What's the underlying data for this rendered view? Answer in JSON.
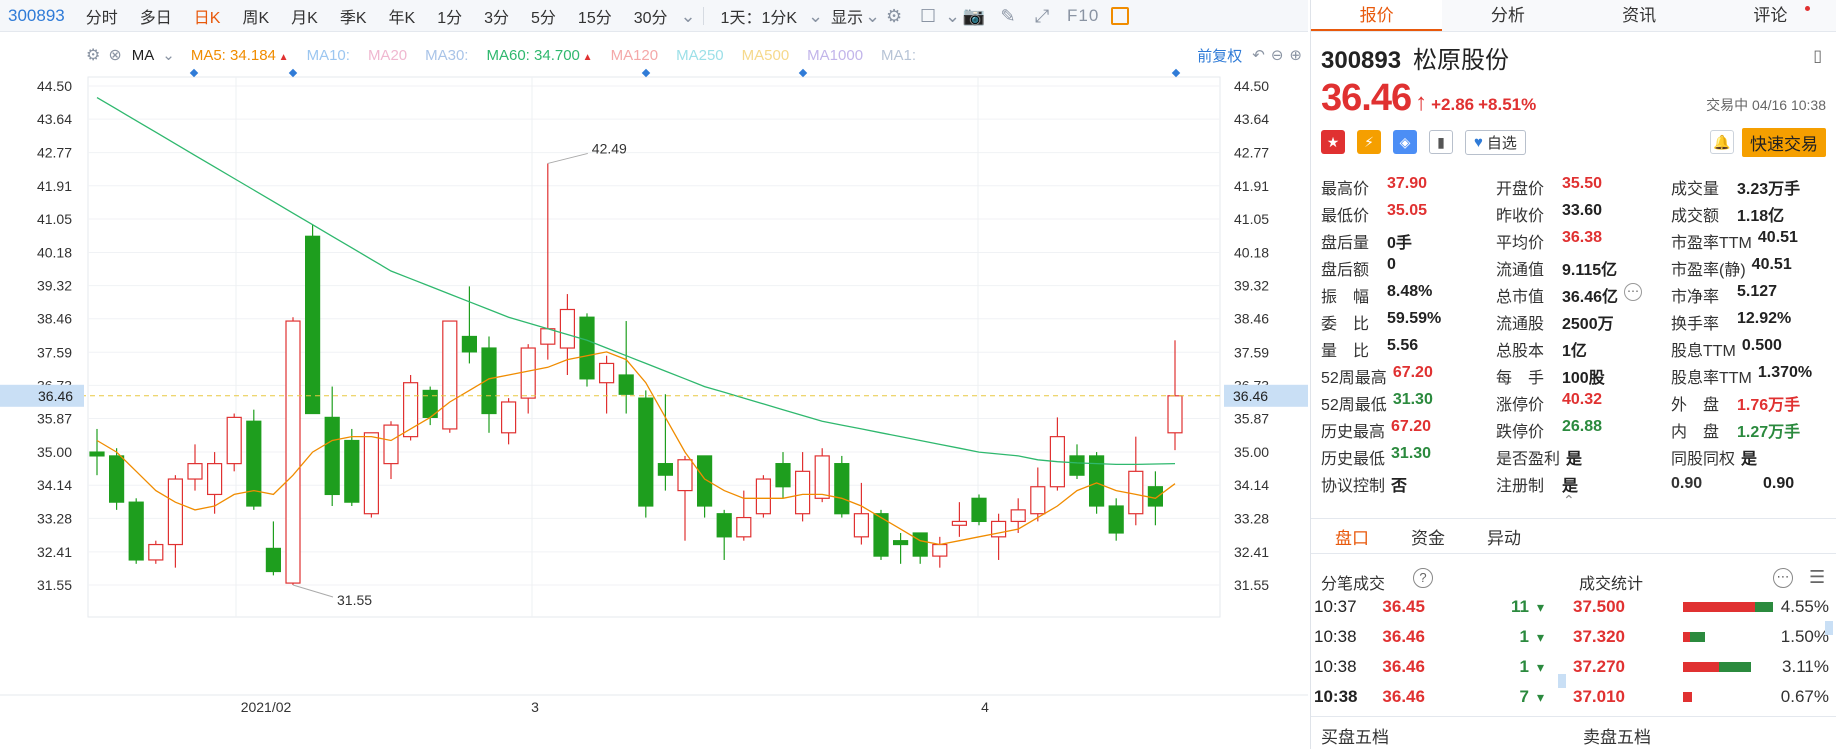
{
  "toolbar": {
    "code": "300893",
    "periods": [
      {
        "label": "分时",
        "active": false
      },
      {
        "label": "多日",
        "active": false
      },
      {
        "label": "日K",
        "active": true
      },
      {
        "label": "周K",
        "active": false
      },
      {
        "label": "月K",
        "active": false
      },
      {
        "label": "季K",
        "active": false
      },
      {
        "label": "年K",
        "active": false
      },
      {
        "label": "1分",
        "active": false
      },
      {
        "label": "3分",
        "active": false
      },
      {
        "label": "5分",
        "active": false
      },
      {
        "label": "15分",
        "active": false
      },
      {
        "label": "30分",
        "active": false
      }
    ],
    "range_label": "1天：1分K",
    "display_label": "显示",
    "f10_label": "F10"
  },
  "ma_bar": {
    "ma_label": "MA",
    "items": [
      {
        "label": "MA5: 34.184",
        "color": "#f08c00",
        "up": true
      },
      {
        "label": "MA10:",
        "color": "#9cc6f0",
        "up": false
      },
      {
        "label": "MA20",
        "color": "#f0b8d0",
        "up": false
      },
      {
        "label": "MA30:",
        "color": "#a9c4e8",
        "up": false
      },
      {
        "label": "MA60: 34.700",
        "color": "#2fb86e",
        "up": true
      },
      {
        "label": "MA120",
        "color": "#f4a8a8",
        "up": false
      },
      {
        "label": "MA250",
        "color": "#9de0e8",
        "up": false
      },
      {
        "label": "MA500",
        "color": "#f6d98c",
        "up": false
      },
      {
        "label": "MA1000",
        "color": "#c2b5ea",
        "up": false
      },
      {
        "label": "MA1:",
        "color": "#b7c4d6",
        "up": false
      }
    ],
    "adjust_label": "前复权"
  },
  "chart_data": {
    "type": "candlestick",
    "y_ticks": [
      "44.50",
      "43.64",
      "42.77",
      "41.91",
      "41.05",
      "40.18",
      "39.32",
      "38.46",
      "37.59",
      "36.73",
      "35.87",
      "35.00",
      "34.14",
      "33.28",
      "32.41",
      "31.55"
    ],
    "ylim": [
      31.55,
      44.5
    ],
    "x_labels": [
      "2021/02",
      "3",
      "4"
    ],
    "current_price_label": "36.46",
    "annotations": [
      {
        "text": "42.49"
      },
      {
        "text": "31.55"
      }
    ],
    "candles": [
      {
        "o": 35.0,
        "h": 35.6,
        "l": 34.4,
        "c": 34.9
      },
      {
        "o": 34.9,
        "h": 35.1,
        "l": 33.5,
        "c": 33.7
      },
      {
        "o": 33.7,
        "h": 33.8,
        "l": 32.1,
        "c": 32.2
      },
      {
        "o": 32.2,
        "h": 32.7,
        "l": 32.1,
        "c": 32.6
      },
      {
        "o": 32.6,
        "h": 34.4,
        "l": 32.0,
        "c": 34.3
      },
      {
        "o": 34.3,
        "h": 35.2,
        "l": 34.0,
        "c": 34.7
      },
      {
        "o": 33.9,
        "h": 35.0,
        "l": 33.4,
        "c": 34.7
      },
      {
        "o": 34.7,
        "h": 36.0,
        "l": 34.5,
        "c": 35.9
      },
      {
        "o": 35.8,
        "h": 36.1,
        "l": 33.5,
        "c": 33.6
      },
      {
        "o": 32.5,
        "h": 33.2,
        "l": 31.8,
        "c": 31.9
      },
      {
        "o": 31.6,
        "h": 38.5,
        "l": 31.55,
        "c": 38.4
      },
      {
        "o": 40.6,
        "h": 40.9,
        "l": 36.0,
        "c": 36.0
      },
      {
        "o": 35.9,
        "h": 36.7,
        "l": 33.6,
        "c": 33.9
      },
      {
        "o": 35.3,
        "h": 35.6,
        "l": 33.6,
        "c": 33.7
      },
      {
        "o": 33.4,
        "h": 35.5,
        "l": 33.3,
        "c": 35.5
      },
      {
        "o": 34.7,
        "h": 35.8,
        "l": 34.3,
        "c": 35.7
      },
      {
        "o": 35.4,
        "h": 37.0,
        "l": 35.3,
        "c": 36.8
      },
      {
        "o": 36.6,
        "h": 36.7,
        "l": 35.7,
        "c": 35.9
      },
      {
        "o": 35.6,
        "h": 38.4,
        "l": 35.5,
        "c": 38.4
      },
      {
        "o": 38.0,
        "h": 39.3,
        "l": 37.3,
        "c": 37.6
      },
      {
        "o": 37.7,
        "h": 38.0,
        "l": 35.5,
        "c": 36.0
      },
      {
        "o": 35.5,
        "h": 36.4,
        "l": 35.2,
        "c": 36.3
      },
      {
        "o": 36.4,
        "h": 37.8,
        "l": 36.0,
        "c": 37.7
      },
      {
        "o": 37.8,
        "h": 42.49,
        "l": 37.4,
        "c": 38.2
      },
      {
        "o": 37.7,
        "h": 39.1,
        "l": 37.0,
        "c": 38.7
      },
      {
        "o": 38.5,
        "h": 38.6,
        "l": 36.7,
        "c": 36.9
      },
      {
        "o": 36.8,
        "h": 37.5,
        "l": 36.0,
        "c": 37.3
      },
      {
        "o": 37.0,
        "h": 38.4,
        "l": 36.0,
        "c": 36.5
      },
      {
        "o": 36.4,
        "h": 36.6,
        "l": 33.3,
        "c": 33.6
      },
      {
        "o": 34.7,
        "h": 36.5,
        "l": 34.0,
        "c": 34.4
      },
      {
        "o": 34.0,
        "h": 34.9,
        "l": 32.7,
        "c": 34.8
      },
      {
        "o": 34.9,
        "h": 34.9,
        "l": 33.3,
        "c": 33.6
      },
      {
        "o": 33.4,
        "h": 33.5,
        "l": 32.2,
        "c": 32.8
      },
      {
        "o": 32.8,
        "h": 34.0,
        "l": 32.7,
        "c": 33.3
      },
      {
        "o": 33.4,
        "h": 34.4,
        "l": 33.3,
        "c": 34.3
      },
      {
        "o": 34.7,
        "h": 35.0,
        "l": 33.8,
        "c": 34.1
      },
      {
        "o": 33.4,
        "h": 35.0,
        "l": 33.2,
        "c": 34.5
      },
      {
        "o": 33.8,
        "h": 35.1,
        "l": 33.7,
        "c": 34.9
      },
      {
        "o": 34.7,
        "h": 34.9,
        "l": 33.3,
        "c": 33.4
      },
      {
        "o": 32.8,
        "h": 34.2,
        "l": 32.6,
        "c": 33.4
      },
      {
        "o": 33.4,
        "h": 33.5,
        "l": 32.2,
        "c": 32.3
      },
      {
        "o": 32.7,
        "h": 32.9,
        "l": 32.1,
        "c": 32.6
      },
      {
        "o": 32.9,
        "h": 32.9,
        "l": 32.1,
        "c": 32.3
      },
      {
        "o": 32.3,
        "h": 32.8,
        "l": 32.0,
        "c": 32.6
      },
      {
        "o": 33.1,
        "h": 33.7,
        "l": 32.8,
        "c": 33.2
      },
      {
        "o": 33.8,
        "h": 33.9,
        "l": 33.1,
        "c": 33.2
      },
      {
        "o": 32.8,
        "h": 33.4,
        "l": 32.2,
        "c": 33.2
      },
      {
        "o": 33.2,
        "h": 33.8,
        "l": 32.9,
        "c": 33.5
      },
      {
        "o": 33.4,
        "h": 34.6,
        "l": 33.2,
        "c": 34.1
      },
      {
        "o": 34.1,
        "h": 35.9,
        "l": 34.0,
        "c": 35.4
      },
      {
        "o": 34.9,
        "h": 35.2,
        "l": 34.3,
        "c": 34.4
      },
      {
        "o": 34.9,
        "h": 35.0,
        "l": 33.4,
        "c": 33.6
      },
      {
        "o": 33.6,
        "h": 33.8,
        "l": 32.7,
        "c": 32.9
      },
      {
        "o": 33.4,
        "h": 35.4,
        "l": 33.1,
        "c": 34.5
      },
      {
        "o": 34.1,
        "h": 34.5,
        "l": 33.1,
        "c": 33.6
      },
      {
        "o": 35.5,
        "h": 37.9,
        "l": 35.05,
        "c": 36.46
      }
    ],
    "ma5": [
      35.3,
      35.0,
      34.5,
      34.0,
      33.7,
      33.5,
      33.6,
      33.9,
      34.0,
      33.9,
      34.4,
      35.0,
      35.3,
      35.4,
      35.4,
      35.3,
      35.6,
      35.9,
      36.3,
      36.6,
      36.9,
      37.0,
      37.1,
      37.2,
      37.4,
      37.5,
      37.6,
      37.4,
      36.8,
      35.9,
      35.0,
      34.3,
      34.0,
      33.8,
      33.8,
      33.8,
      33.9,
      33.9,
      33.8,
      33.6,
      33.3,
      33.0,
      32.7,
      32.6,
      32.7,
      32.8,
      32.9,
      33.0,
      33.3,
      33.6,
      34.0,
      34.2,
      34.0,
      33.9,
      33.8,
      34.18
    ],
    "ma60": [
      44.2,
      43.9,
      43.6,
      43.3,
      43.0,
      42.7,
      42.4,
      42.1,
      41.8,
      41.5,
      41.2,
      40.9,
      40.6,
      40.3,
      40.0,
      39.7,
      39.5,
      39.3,
      39.1,
      38.9,
      38.7,
      38.5,
      38.35,
      38.2,
      38.05,
      37.9,
      37.7,
      37.5,
      37.3,
      37.1,
      36.9,
      36.7,
      36.55,
      36.4,
      36.25,
      36.1,
      35.95,
      35.8,
      35.7,
      35.6,
      35.5,
      35.4,
      35.3,
      35.2,
      35.1,
      35.0,
      34.95,
      34.9,
      34.8,
      34.75,
      34.72,
      34.7,
      34.68,
      34.68,
      34.69,
      34.7
    ]
  },
  "right_panel": {
    "tabs": [
      {
        "label": "报价",
        "active": true
      },
      {
        "label": "分析",
        "active": false
      },
      {
        "label": "资讯",
        "active": false
      },
      {
        "label": "评论",
        "active": false
      }
    ],
    "stock_code": "300893",
    "stock_name": "松原股份",
    "price": "36.46",
    "change": "+2.86",
    "change_pct": "+8.51%",
    "status_time": "交易中 04/16 10:38",
    "favorite_label": "自选",
    "quick_trade_label": "快速交易",
    "quote_rows": [
      [
        {
          "label": "最高价",
          "value": "37.90",
          "color": "red"
        },
        {
          "label": "开盘价",
          "value": "35.50",
          "color": "red"
        },
        {
          "label": "成交量",
          "value": "3.23万手",
          "color": "dark"
        }
      ],
      [
        {
          "label": "最低价",
          "value": "35.05",
          "color": "red"
        },
        {
          "label": "昨收价",
          "value": "33.60",
          "color": "dark"
        },
        {
          "label": "成交额",
          "value": "1.18亿",
          "color": "dark"
        }
      ],
      [
        {
          "label": "盘后量",
          "value": "0手",
          "color": "dark"
        },
        {
          "label": "平均价",
          "value": "36.38",
          "color": "red"
        },
        {
          "label": "市盈率TTM",
          "value": "40.51",
          "color": "dark"
        }
      ],
      [
        {
          "label": "盘后额",
          "value": "0",
          "color": "dark"
        },
        {
          "label": "流通值",
          "value": "9.115亿",
          "color": "dark"
        },
        {
          "label": "市盈率(静)",
          "value": "40.51",
          "color": "dark"
        }
      ],
      [
        {
          "label": "振　幅",
          "value": "8.48%",
          "color": "dark"
        },
        {
          "label": "总市值",
          "value": "36.46亿",
          "color": "dark"
        },
        {
          "label": "市净率",
          "value": "5.127",
          "color": "dark"
        }
      ],
      [
        {
          "label": "委　比",
          "value": "59.59%",
          "color": "dark"
        },
        {
          "label": "流通股",
          "value": "2500万",
          "color": "dark"
        },
        {
          "label": "换手率",
          "value": "12.92%",
          "color": "dark"
        }
      ],
      [
        {
          "label": "量　比",
          "value": "5.56",
          "color": "dark"
        },
        {
          "label": "总股本",
          "value": "1亿",
          "color": "dark"
        },
        {
          "label": "股息TTM",
          "value": "0.500",
          "color": "dark"
        }
      ],
      [
        {
          "label": "52周最高",
          "value": "67.20",
          "color": "red"
        },
        {
          "label": "每　手",
          "value": "100股",
          "color": "dark"
        },
        {
          "label": "股息率TTM",
          "value": "1.370%",
          "color": "dark"
        }
      ],
      [
        {
          "label": "52周最低",
          "value": "31.30",
          "color": "green"
        },
        {
          "label": "涨停价",
          "value": "40.32",
          "color": "red"
        },
        {
          "label": "外　盘",
          "value": "1.76万手",
          "color": "red"
        }
      ],
      [
        {
          "label": "历史最高",
          "value": "67.20",
          "color": "red"
        },
        {
          "label": "跌停价",
          "value": "26.88",
          "color": "green"
        },
        {
          "label": "内　盘",
          "value": "1.27万手",
          "color": "green"
        }
      ],
      [
        {
          "label": "历史最低",
          "value": "31.30",
          "color": "green"
        },
        {
          "label": "是否盈利",
          "value": "是",
          "color": "dark"
        },
        {
          "label": "同股同权",
          "value": "是",
          "color": "dark"
        }
      ],
      [
        {
          "label": "协议控制",
          "value": "否",
          "color": "dark"
        },
        {
          "label": "注册制",
          "value": "是",
          "color": "dark"
        },
        {
          "label": "0.90",
          "value": "0.90",
          "color": "dark"
        }
      ]
    ],
    "sub_tabs": [
      {
        "label": "盘口",
        "active": true
      },
      {
        "label": "资金",
        "active": false
      },
      {
        "label": "异动",
        "active": false
      }
    ],
    "trades_title": "分笔成交",
    "trades": [
      {
        "time": "10:37",
        "price": "36.45",
        "vol": "11"
      },
      {
        "time": "10:38",
        "price": "36.46",
        "vol": "1"
      },
      {
        "time": "10:38",
        "price": "36.46",
        "vol": "1"
      },
      {
        "time": "10:38",
        "price": "36.46",
        "vol": "7"
      }
    ],
    "stats_title": "成交统计",
    "stats": [
      {
        "price": "37.500",
        "pct": "4.55%",
        "red": 0.8,
        "green": 0.2
      },
      {
        "price": "37.320",
        "pct": "1.50%",
        "red": 0.08,
        "green": 0.17
      },
      {
        "price": "37.270",
        "pct": "3.11%",
        "red": 0.4,
        "green": 0.35
      },
      {
        "price": "37.010",
        "pct": "0.67%",
        "red": 0.1,
        "green": 0.0
      }
    ],
    "buy_five_label": "买盘五档",
    "sell_five_label": "卖盘五档"
  }
}
